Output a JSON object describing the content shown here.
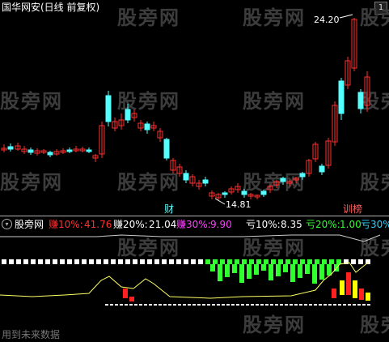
{
  "main_panel": {
    "title": "国华网安(日线 前复权)",
    "scroll_indicator": "1",
    "watermark": "股旁网",
    "price_high_label": "24.20",
    "price_low_label": "14.81",
    "event_marker_1": "财",
    "event_marker_2": "训榜"
  },
  "indicator_panel": {
    "collapse_icon": "circle-arrow-down-icon",
    "name": "股旁网",
    "items": [
      {
        "label": "赚10%:",
        "value": "41.76",
        "color": "#ff3030"
      },
      {
        "label": "赚20%:",
        "value": "21.04",
        "color": "#ffffff"
      },
      {
        "label": "赚30%:",
        "value": "9.90",
        "color": "#ff40ff"
      },
      {
        "label": "亏10%:",
        "value": "8.35",
        "color": "#ffffff"
      },
      {
        "label": "亏20%:",
        "value": "1.00",
        "color": "#30ff30"
      },
      {
        "label": "亏30%",
        "value": "",
        "color": "#30d0ff"
      }
    ],
    "footer_text": "用到未来数据"
  },
  "colors": {
    "background": "#000000",
    "candle_up": "#ff3030",
    "candle_down": "#54ffff",
    "text_default": "#ffffff",
    "divider": "#b0b0b0",
    "indicator_line": "#ffff66"
  }
}
